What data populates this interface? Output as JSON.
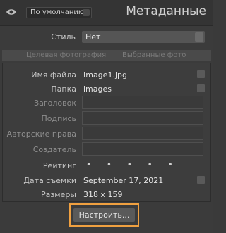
{
  "header": {
    "preset_value": "По умолчанию",
    "title": "Метаданные"
  },
  "style": {
    "label": "Стиль",
    "value": "Нет"
  },
  "tabs": [
    "Целевая фотография",
    "Выбранные фото"
  ],
  "rows": [
    {
      "key": "Имя файла",
      "value": "Image1.jpg"
    },
    {
      "key": "Папка",
      "value": "images"
    },
    {
      "key": "Заголовок",
      "value": ""
    },
    {
      "key": "Подпись",
      "value": ""
    },
    {
      "key": "Авторские права",
      "value": ""
    },
    {
      "key": "Создатель",
      "value": ""
    },
    {
      "key": "Рейтинг",
      "value": "• • • • •"
    },
    {
      "key": "Дата съемки",
      "value": "September 17, 2021"
    },
    {
      "key": "Размеры",
      "value": "318 x 159"
    }
  ],
  "footer": {
    "customize_label": "Настроить..."
  }
}
